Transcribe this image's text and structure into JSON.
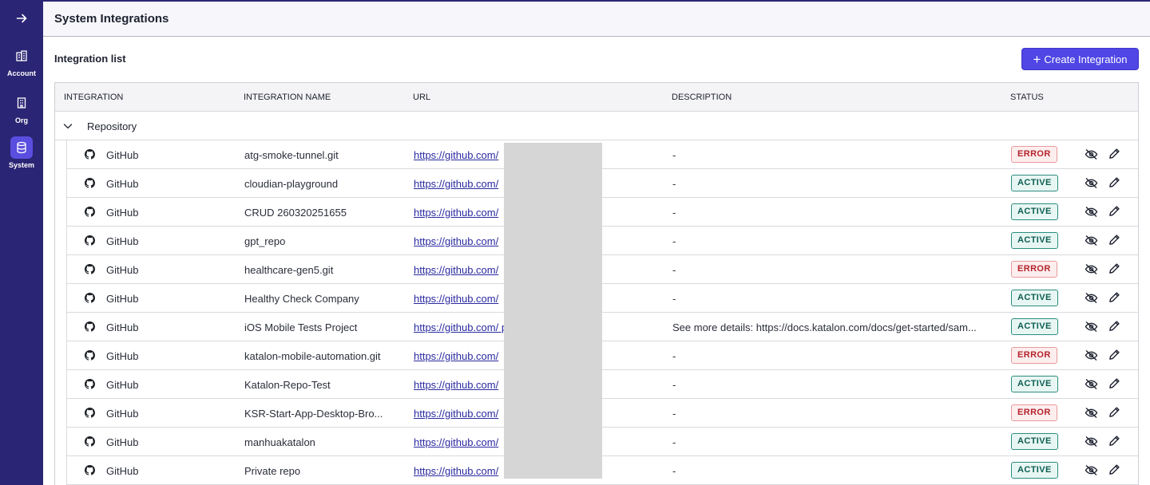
{
  "sidebar": {
    "expand_icon": "arrow-right-icon",
    "items": [
      {
        "label": "Account",
        "icon": "account-icon"
      },
      {
        "label": "Org",
        "icon": "org-icon"
      },
      {
        "label": "System",
        "icon": "database-icon",
        "active": true
      }
    ]
  },
  "header": {
    "title": "System Integrations"
  },
  "section": {
    "title": "Integration list"
  },
  "create_button": {
    "label": "Create Integration",
    "icon": "plus-icon"
  },
  "table": {
    "columns": [
      "INTEGRATION",
      "INTEGRATION NAME",
      "URL",
      "DESCRIPTION",
      "STATUS"
    ],
    "group": {
      "label": "Repository",
      "expanded": true
    },
    "rows": [
      {
        "type": "GitHub",
        "name": "atg-smoke-tunnel.git",
        "url": "https://github.com/",
        "description": "-",
        "status": "ERROR"
      },
      {
        "type": "GitHub",
        "name": "cloudian-playground",
        "url": "https://github.com/",
        "description": "-",
        "status": "ACTIVE"
      },
      {
        "type": "GitHub",
        "name": "CRUD 260320251655",
        "url": "https://github.com/",
        "description": "-",
        "status": "ACTIVE"
      },
      {
        "type": "GitHub",
        "name": "gpt_repo",
        "url": "https://github.com/",
        "description": "-",
        "status": "ACTIVE"
      },
      {
        "type": "GitHub",
        "name": "healthcare-gen5.git",
        "url": "https://github.com/",
        "description": "-",
        "status": "ERROR"
      },
      {
        "type": "GitHub",
        "name": "Healthy Check Company",
        "url": "https://github.com/",
        "description": "-",
        "status": "ACTIVE"
      },
      {
        "type": "GitHub",
        "name": "iOS Mobile Tests Project",
        "url": "https://github.com/                            ples",
        "description": "See more details: https://docs.katalon.com/docs/get-started/sam...",
        "status": "ACTIVE"
      },
      {
        "type": "GitHub",
        "name": "katalon-mobile-automation.git",
        "url": "https://github.com/",
        "description": "-",
        "status": "ERROR"
      },
      {
        "type": "GitHub",
        "name": "Katalon-Repo-Test",
        "url": "https://github.com/",
        "description": "-",
        "status": "ACTIVE"
      },
      {
        "type": "GitHub",
        "name": "KSR-Start-App-Desktop-Bro...",
        "url": "https://github.com/",
        "description": "-",
        "status": "ERROR"
      },
      {
        "type": "GitHub",
        "name": "manhuakatalon",
        "url": "https://github.com/",
        "description": "-",
        "status": "ACTIVE"
      },
      {
        "type": "GitHub",
        "name": "Private repo",
        "url": "https://github.com/",
        "description": "-",
        "status": "ACTIVE"
      }
    ]
  },
  "colors": {
    "sidebar_bg": "#2a2574",
    "accent": "#4f46e5",
    "error": "#b4232a",
    "active": "#0d5e52"
  }
}
